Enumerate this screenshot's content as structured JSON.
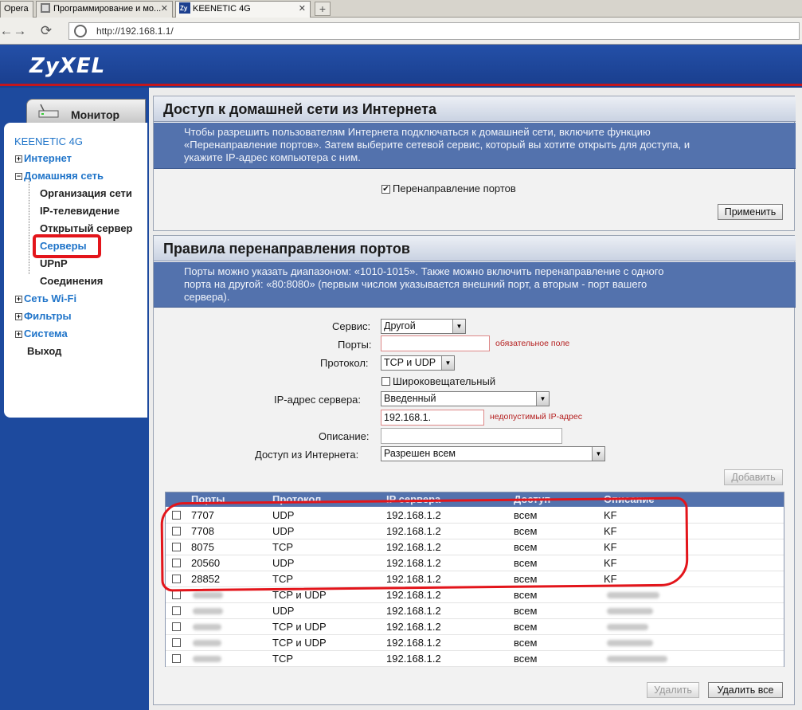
{
  "browser": {
    "tabs": [
      {
        "label": "Opera"
      },
      {
        "label": "Программирование и мо..."
      },
      {
        "label": "KEENETIC 4G"
      }
    ],
    "new_tab": "+",
    "close_glyph": "✕",
    "address": "http://192.168.1.1/"
  },
  "header": {
    "logo": "ZyXEL"
  },
  "sidebar": {
    "monitor_tab": "Монитор",
    "device": "KEENETIC 4G",
    "items": [
      {
        "label": "Интернет",
        "expander": "+"
      },
      {
        "label": "Домашняя сеть",
        "expander": "−"
      },
      {
        "label": "Организация сети"
      },
      {
        "label": "IP-телевидение"
      },
      {
        "label": "Открытый сервер"
      },
      {
        "label": "Серверы"
      },
      {
        "label": "UPnP"
      },
      {
        "label": "Соединения"
      },
      {
        "label": "Сеть Wi-Fi",
        "expander": "+"
      },
      {
        "label": "Фильтры",
        "expander": "+"
      },
      {
        "label": "Система",
        "expander": "+"
      },
      {
        "label": "Выход"
      }
    ]
  },
  "access_panel": {
    "title": "Доступ к домашней сети из Интернета",
    "desc_lines": [
      "Чтобы разрешить пользователям Интернета подключаться к домашней сети, включите функцию",
      "«Перенаправление портов». Затем выберите сетевой сервис, который вы хотите открыть для доступа, и",
      "укажите IP-адрес компьютера с ним."
    ],
    "forwarding_label": "Перенаправление портов",
    "forwarding_checked": true,
    "apply_button": "Применить"
  },
  "rules_panel": {
    "title": "Правила перенаправления портов",
    "desc_lines": [
      "Порты можно указать диапазоном: «1010-1015». Также можно включить перенаправление с одного",
      "порта на другой: «80:8080» (первым числом указывается внешний порт, а вторым - порт вашего",
      "сервера)."
    ],
    "form": {
      "service_label": "Сервис:",
      "service_value": "Другой",
      "ports_label": "Порты:",
      "ports_value": "",
      "ports_error": "обязательное поле",
      "protocol_label": "Протокол:",
      "protocol_value": "TCP и UDP",
      "broadcast_label": "Широковещательный",
      "ip_label": "IP-адрес сервера:",
      "ip_mode_value": "Введенный",
      "ip_value": "192.168.1.",
      "ip_error": "недопустимый IP-адрес",
      "desc_label": "Описание:",
      "desc_value": "",
      "access_label": "Доступ из Интернета:",
      "access_value": "Разрешен всем"
    },
    "add_button": "Добавить",
    "table": {
      "columns": [
        "Порты",
        "Протокол",
        "IP сервера",
        "Доступ",
        "Описание"
      ],
      "rows": [
        {
          "port": "7707",
          "protocol": "UDP",
          "ip": "192.168.1.2",
          "access": "всем",
          "desc": "KF"
        },
        {
          "port": "7708",
          "protocol": "UDP",
          "ip": "192.168.1.2",
          "access": "всем",
          "desc": "KF"
        },
        {
          "port": "8075",
          "protocol": "TCP",
          "ip": "192.168.1.2",
          "access": "всем",
          "desc": "KF"
        },
        {
          "port": "20560",
          "protocol": "UDP",
          "ip": "192.168.1.2",
          "access": "всем",
          "desc": "KF"
        },
        {
          "port": "28852",
          "protocol": "TCP",
          "ip": "192.168.1.2",
          "access": "всем",
          "desc": "KF"
        },
        {
          "port": "",
          "protocol": "TCP и UDP",
          "ip": "192.168.1.2",
          "access": "всем",
          "desc": ""
        },
        {
          "port": "",
          "protocol": "UDP",
          "ip": "192.168.1.2",
          "access": "всем",
          "desc": ""
        },
        {
          "port": "",
          "protocol": "TCP и UDP",
          "ip": "192.168.1.2",
          "access": "всем",
          "desc": ""
        },
        {
          "port": "",
          "protocol": "TCP и UDP",
          "ip": "192.168.1.2",
          "access": "всем",
          "desc": ""
        },
        {
          "port": "",
          "protocol": "TCP",
          "ip": "192.168.1.2",
          "access": "всем",
          "desc": ""
        }
      ]
    },
    "delete_button": "Удалить",
    "delete_all_button": "Удалить все"
  },
  "colors": {
    "brand_blue": "#1c3f8e",
    "accent_red": "#e3151b",
    "table_header": "#5372ad"
  }
}
